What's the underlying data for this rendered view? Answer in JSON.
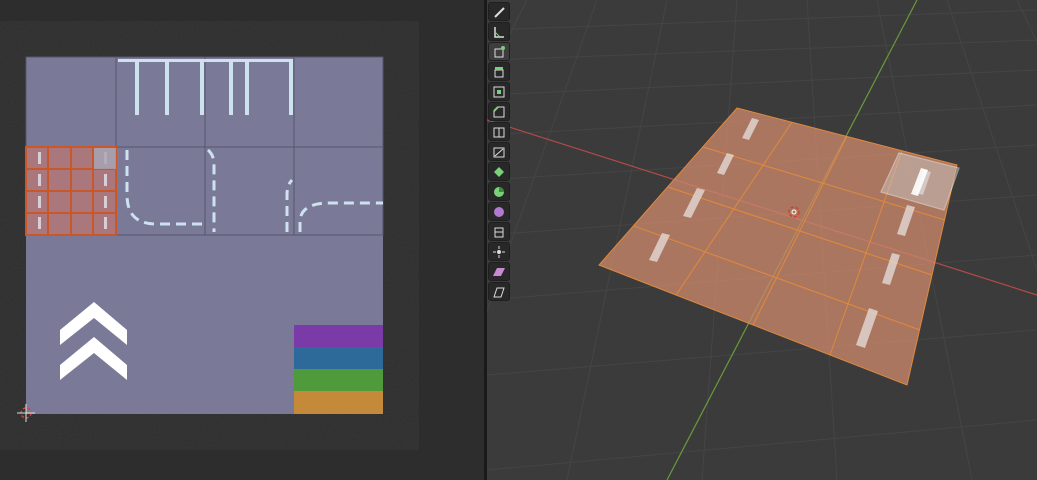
{
  "uv_editor": {
    "tiles": [
      "asphalt",
      "parking-lines",
      "parking-lines",
      "asphalt",
      "selected-grid",
      "curve-left",
      "curve-mid",
      "curve-right"
    ],
    "color_swatches": [
      "#7a3ba8",
      "#2d6a9a",
      "#4f9a3a",
      "#c48a3a"
    ],
    "selection_color": "#c86a3a"
  },
  "viewport": {
    "plane_color": "#c8866a",
    "edge_color": "#e08a3a",
    "x_axis_color": "#b34a4a",
    "y_axis_color": "#6a9a3a",
    "active_face_color": "#cfcfcf"
  },
  "toolbar": {
    "tools": [
      "annotate-icon",
      "measure-icon",
      "add-cube-icon",
      "extrude-icon",
      "inset-icon",
      "bevel-icon",
      "loop-cut-icon",
      "knife-icon",
      "poly-build-icon",
      "spin-icon",
      "smooth-icon",
      "edge-slide-icon",
      "shrink-fatten-icon",
      "shear-icon",
      "rip-icon"
    ]
  }
}
